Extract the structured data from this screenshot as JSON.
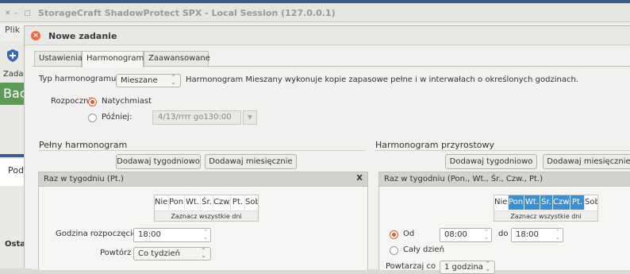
{
  "main_window": {
    "title": "StorageCraft ShadowProtect SPX - Local Session (127.0.0.1)",
    "menu_plik": "Plik",
    "left_labels": {
      "zadan": "Zadan",
      "bac": "Bac",
      "pod": "Pod",
      "ostat": "Ostat"
    }
  },
  "dialog": {
    "title": "Nowe zadanie",
    "tabs": [
      "Ustawienia",
      "Harmonogram",
      "Zaawansowane"
    ],
    "active_tab": "Harmonogram",
    "schedule_type_label": "Typ harmonogramu",
    "schedule_type_value": "Mieszane",
    "schedule_type_desc": "Harmonogram Mieszany wykonuje kopie zapasowe pełne i w interwałach o określonych godzinach.",
    "start_label": "Rozpocznij",
    "start_now": "Natychmiast",
    "start_later": "Później:",
    "later_datetime": "4/13/rrrr go130:00"
  },
  "full": {
    "title": "Pełny harmonogram",
    "btn_weekly": "Dodawaj tygodniowo",
    "btn_monthly": "Dodawaj miesięcznie",
    "panel_title": "Raz w tygodniu (Pt.)",
    "close": "X",
    "days": [
      "Nied.",
      "Pon.",
      "Wt.",
      "Śr.",
      "Czw.",
      "Pt.",
      "Sob"
    ],
    "selected_days": [
      5
    ],
    "select_all": "Zaznacz wszystkie dni",
    "start_time_label": "Godzina rozpoczęcie",
    "start_time": "18:00",
    "repeat_label": "Powtórz",
    "repeat_value": "Co tydzień"
  },
  "incr": {
    "title": "Harmonogram przyrostowy",
    "btn_weekly": "Dodawaj tygodniowo",
    "btn_monthly": "Dodawaj miesięcznie",
    "panel_title": "Raz w tygodniu (Pon., Wt., Śr., Czw., Pt.)",
    "days": [
      "Nied.",
      "Pon.",
      "Wt.",
      "Śr.",
      "Czw.",
      "Pt.",
      "Sob"
    ],
    "selected_days": [
      1,
      2,
      3,
      4,
      5
    ],
    "select_all": "Zaznacz wszystkie dni",
    "od_label": "Od",
    "od_time": "08:00",
    "do_label": "do",
    "do_time": "18:00",
    "all_day": "Cały dzień",
    "repeat_label": "Powtarzaj co",
    "repeat_value": "1 godzina"
  }
}
